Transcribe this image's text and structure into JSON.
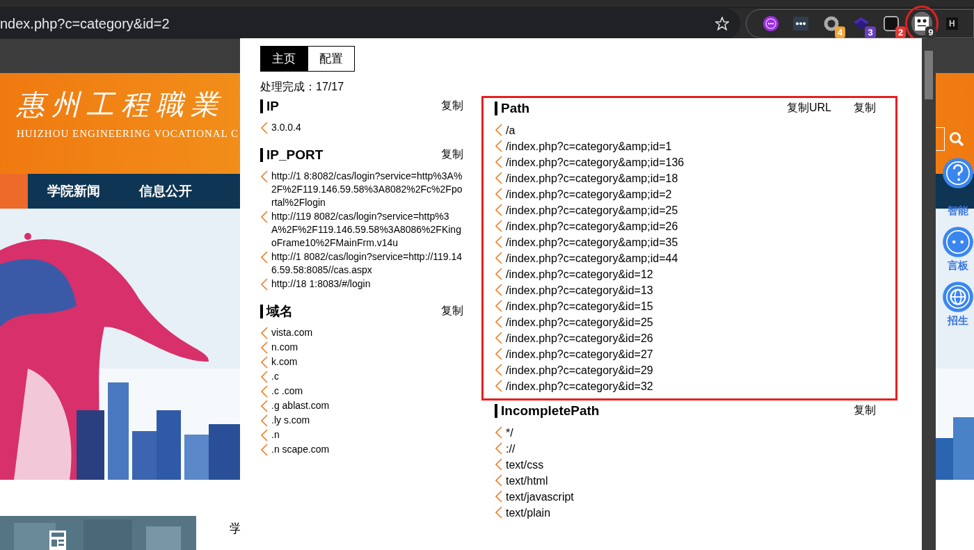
{
  "browser": {
    "address": "ndex.php?c=category&id=2",
    "extensions": [
      {
        "kind": "chat",
        "highlighted": false
      },
      {
        "kind": "dots",
        "highlighted": false
      },
      {
        "kind": "ring",
        "badge": "4",
        "color": "#f0a43a",
        "highlighted": false
      },
      {
        "kind": "layers",
        "badge": "3",
        "color": "#6a3fc2",
        "highlighted": false
      },
      {
        "kind": "box",
        "badge": "2",
        "color": "#e53935",
        "highlighted": false
      },
      {
        "kind": "panda",
        "badge": "9",
        "color": "#333333",
        "highlighted": true
      },
      {
        "kind": "letter",
        "letter": "H",
        "highlighted": false
      }
    ]
  },
  "page": {
    "logo_cn": "惠州工程職業",
    "logo_en": "HUIZHOU ENGINEERING VOCATIONAL C",
    "nav": [
      "学院新闻",
      "信息公开"
    ],
    "side_tools": [
      {
        "kind": "question",
        "label": "智能"
      },
      {
        "kind": "chat",
        "label": "言板"
      },
      {
        "kind": "globe",
        "label": "招生"
      }
    ],
    "snippet": "学"
  },
  "popup": {
    "tabs": [
      {
        "label": "主页",
        "selected": true
      },
      {
        "label": "配置",
        "selected": false
      }
    ],
    "status": "处理完成：17/17",
    "columns": [
      [
        {
          "title": "IP",
          "highlighted": false,
          "actions": [
            "复制"
          ],
          "items": [
            "3.0.0.4"
          ]
        },
        {
          "title": "IP_PORT",
          "highlighted": false,
          "actions": [
            "复制"
          ],
          "items": [
            "http://1 8:8082/cas/login?service=http%3A%2F%2F119.146.59.58%3A8082%2Fc%2Fportal%2Flogin",
            "http://119 8082/cas/login?service=http%3A%2F%2F119.146.59.58%3A8086%2FKingoFrame10%2FMainFrm.v14u",
            "http://1 8082/cas/login?service=http://119.146.59.58:8085//cas.aspx",
            "http://18 1:8083/#/login"
          ]
        },
        {
          "title": "域名",
          "highlighted": false,
          "actions": [
            "复制"
          ],
          "items": [
            "vista.com",
            "n.com",
            "k.com",
            ".c",
            ".c .com",
            ".g ablast.com",
            ".ly s.com",
            ".n",
            ".n scape.com"
          ]
        }
      ],
      [
        {
          "title": "Path",
          "highlighted": true,
          "actions": [
            "复制URL",
            "复制"
          ],
          "items": [
            "/a",
            "/index.php?c=category&amp;id=1",
            "/index.php?c=category&amp;id=136",
            "/index.php?c=category&amp;id=18",
            "/index.php?c=category&amp;id=2",
            "/index.php?c=category&amp;id=25",
            "/index.php?c=category&amp;id=26",
            "/index.php?c=category&amp;id=35",
            "/index.php?c=category&amp;id=44",
            "/index.php?c=category&id=12",
            "/index.php?c=category&id=13",
            "/index.php?c=category&id=15",
            "/index.php?c=category&id=25",
            "/index.php?c=category&id=26",
            "/index.php?c=category&id=27",
            "/index.php?c=category&id=29",
            "/index.php?c=category&id=32"
          ]
        },
        {
          "title": "IncompletePath",
          "highlighted": false,
          "actions": [
            "复制"
          ],
          "items": [
            "*/",
            "://",
            "text/css",
            "text/html",
            "text/javascript",
            "text/plain"
          ]
        }
      ]
    ]
  }
}
